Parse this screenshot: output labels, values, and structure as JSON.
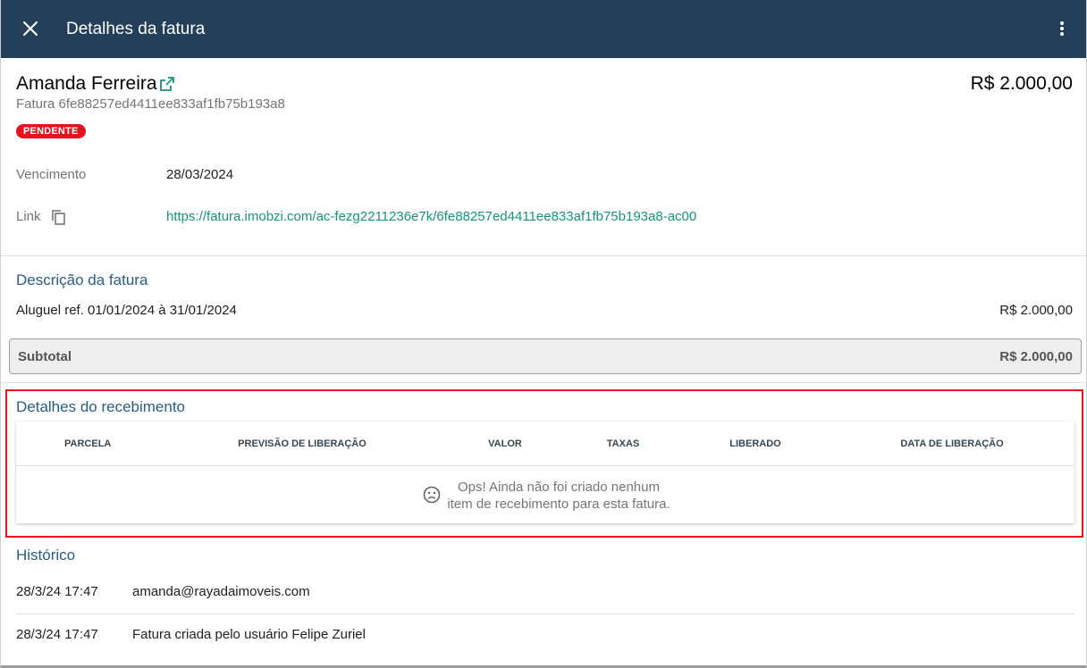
{
  "appbar": {
    "title": "Detalhes da fatura",
    "close_icon": "close-icon",
    "more_icon": "more-vertical-icon",
    "background": "#233f5a"
  },
  "invoice": {
    "customer_name": "Amanda Ferreira",
    "amount": "R$ 2.000,00",
    "id_label": "Fatura 6fe88257ed4411ee833af1fb75b193a8",
    "status": "PENDENTE",
    "status_color": "#e8121c"
  },
  "fields": {
    "due_label": "Vencimento",
    "due_value": "28/03/2024",
    "link_label": "Link",
    "link_value": "https://fatura.imobzi.com/ac-fezg2211236e7k/6fe88257ed4411ee833af1fb75b193a8-ac00"
  },
  "description": {
    "title": "Descrição da fatura",
    "item_label": "Aluguel ref. 01/01/2024 à 31/01/2024",
    "item_amount": "R$ 2.000,00",
    "subtotal_label": "Subtotal",
    "subtotal_amount": "R$ 2.000,00"
  },
  "receipt": {
    "title": "Detalhes do recebimento",
    "columns": [
      "PARCELA",
      "PREVISÃO DE LIBERAÇÃO",
      "VALOR",
      "TAXAS",
      "LIBERADO",
      "DATA DE LIBERAÇÃO"
    ],
    "empty_line1": "Ops! Ainda não foi criado nenhum",
    "empty_line2": "item de recebimento para esta fatura."
  },
  "history": {
    "title": "Histórico",
    "entries": [
      {
        "time": "28/3/24 17:47",
        "text": "amanda@rayadaimoveis.com"
      },
      {
        "time": "28/3/24 17:47",
        "text": "Fatura criada pelo usuário Felipe Zuriel"
      }
    ]
  }
}
